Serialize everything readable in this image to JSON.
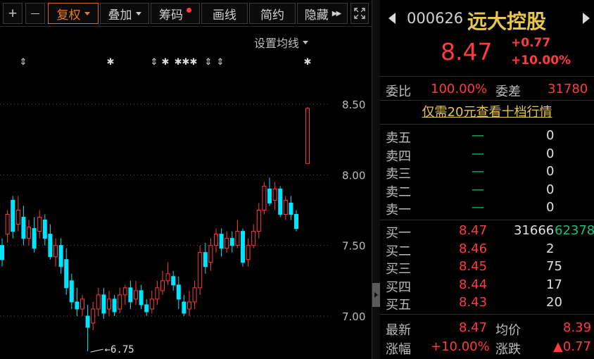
{
  "toolbar": {
    "plus": "+",
    "minus": "—",
    "fuquan": "复权",
    "diejia": "叠加",
    "chouma": "筹码",
    "huaxian": "画线",
    "jianyue": "简约",
    "yincang": "隐藏",
    "hide_arrows": "▶▶"
  },
  "chart": {
    "ma_setting": "设置均线",
    "low_annotation": "6.75",
    "markers": [
      "⇕",
      "✱",
      "⇕",
      "✱",
      "✱✱✱",
      "⇕",
      "⇕",
      "✱"
    ],
    "colors": {
      "up": "#ff3b3b",
      "down": "#00e5ff",
      "grid": "#5a5a5a"
    }
  },
  "chart_data": {
    "type": "candlestick",
    "y_ticks": [
      "8.50",
      "8.00",
      "7.50",
      "7.00"
    ],
    "ylim": [
      6.75,
      8.5
    ],
    "annotations": [
      {
        "text": "6.75"
      }
    ]
  },
  "quote": {
    "code": "000626",
    "name": "远大控股",
    "price": "8.47",
    "change": "+0.77",
    "change_pct": "+10.00%",
    "weibi_label": "委比",
    "weibi_value": "100.00%",
    "weicha_label": "委差",
    "weicha_value": "31780",
    "promo": "仅需20元查看十档行情",
    "sell": [
      {
        "label": "卖五",
        "price": "—",
        "vol": "0"
      },
      {
        "label": "卖四",
        "price": "—",
        "vol": "0"
      },
      {
        "label": "卖三",
        "price": "—",
        "vol": "0"
      },
      {
        "label": "卖二",
        "price": "—",
        "vol": "0"
      },
      {
        "label": "卖一",
        "price": "—",
        "vol": "0"
      }
    ],
    "buy": [
      {
        "label": "买一",
        "price": "8.47",
        "vol": "31666",
        "extra": "62378"
      },
      {
        "label": "买二",
        "price": "8.46",
        "vol": "2",
        "extra": ""
      },
      {
        "label": "买三",
        "price": "8.45",
        "vol": "75",
        "extra": ""
      },
      {
        "label": "买四",
        "price": "8.44",
        "vol": "17",
        "extra": ""
      },
      {
        "label": "买五",
        "price": "8.43",
        "vol": "20",
        "extra": ""
      }
    ],
    "latest_label": "最新",
    "latest_value": "8.47",
    "avg_label": "均价",
    "avg_value": "8.39",
    "zhangfu_label": "涨幅",
    "zhangfu_value": "+10.00%",
    "zhangdie_label": "涨跌",
    "zhangdie_value": "▲0.77"
  }
}
